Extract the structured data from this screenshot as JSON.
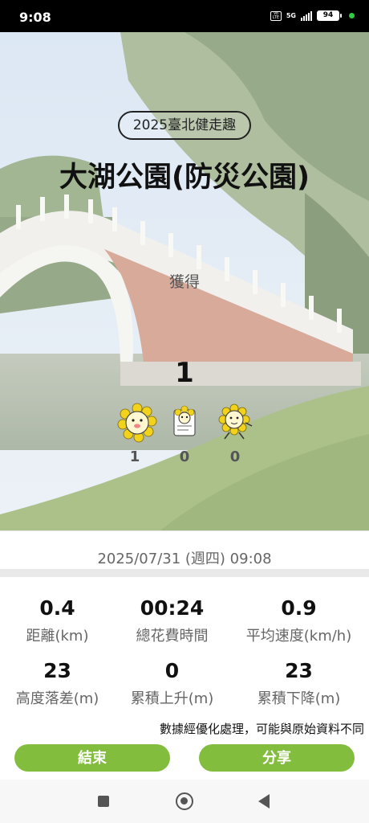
{
  "status_bar": {
    "time": "9:08",
    "volte_label": "Vo LTE",
    "network": "5G",
    "battery": "94"
  },
  "hero": {
    "event_name": "2025臺北健走趣",
    "park_name": "大湖公園(防災公園)",
    "obtained_label": "獲得",
    "total_count": "1",
    "badges": [
      {
        "icon": "sunflower-mascot-icon",
        "count": "1"
      },
      {
        "icon": "sunflower-card-icon",
        "count": "0"
      },
      {
        "icon": "sunflower-running-icon",
        "count": "0"
      }
    ]
  },
  "session": {
    "date": "2025/07/31 (週四) 09:08"
  },
  "stats": [
    {
      "value": "0.4",
      "label": "距離(km)"
    },
    {
      "value": "00:24",
      "label": "總花費時間"
    },
    {
      "value": "0.9",
      "label": "平均速度(km/h)"
    },
    {
      "value": "23",
      "label": "高度落差(m)"
    },
    {
      "value": "0",
      "label": "累積上升(m)"
    },
    {
      "value": "23",
      "label": "累積下降(m)"
    }
  ],
  "note": "數據經優化處理，可能與原始資料不同",
  "actions": {
    "end_label": "結束",
    "share_label": "分享"
  },
  "colors": {
    "button_green": "#82bd3d",
    "sunflower_yellow": "#f2d21b"
  }
}
